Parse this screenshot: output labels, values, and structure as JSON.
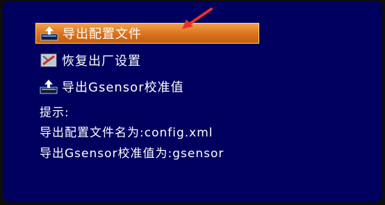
{
  "menu": {
    "items": [
      {
        "label": "导出配置文件",
        "icon": "export-icon",
        "selected": true
      },
      {
        "label": "恢复出厂设置",
        "icon": "reset-icon",
        "selected": false
      },
      {
        "label": "导出Gsensor校准值",
        "icon": "export-icon",
        "selected": false
      }
    ]
  },
  "tips": {
    "heading": "提示:",
    "lines": [
      "导出配置文件名为:config.xml",
      "导出Gsensor校准值为:gsensor"
    ]
  },
  "colors": {
    "background": "#00005f",
    "highlight": "#d9711c",
    "pointer": "#e8322a",
    "text": "#ffffff"
  }
}
